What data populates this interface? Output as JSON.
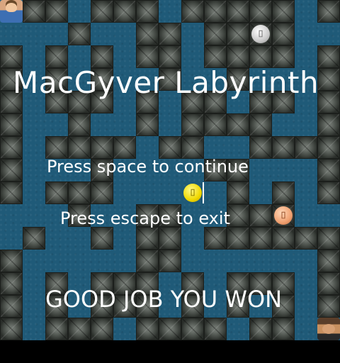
{
  "game": {
    "title": "MacGyver Labyrinth",
    "prompt_continue": "Press space to continue",
    "prompt_exit": "Press escape to exit",
    "result": "GOOD JOB YOU WON"
  },
  "colors": {
    "floor": "#1f5a78",
    "wall": "#3b403b",
    "text": "#ffffff"
  },
  "items": [
    {
      "kind": "silver-coin-icon",
      "glyph": "⌷"
    },
    {
      "kind": "gold-coin-icon",
      "glyph": "⌷"
    },
    {
      "kind": "copper-coin-icon",
      "glyph": "⌷"
    }
  ]
}
